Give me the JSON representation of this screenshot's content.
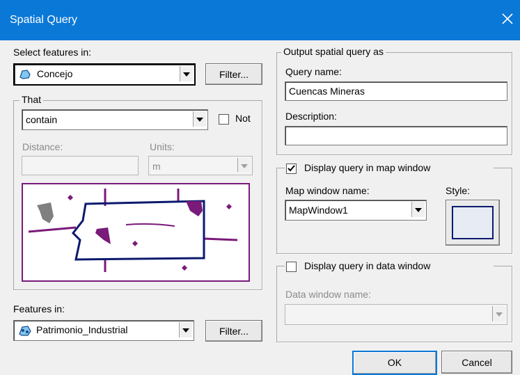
{
  "window": {
    "title": "Spatial Query",
    "close": "✕"
  },
  "select_features": {
    "label": "Select features in:",
    "layer": "Concejo",
    "filter_button": "Filter..."
  },
  "that": {
    "group_label": "That",
    "operator": "contain",
    "not_label": "Not",
    "not_checked": false,
    "distance_label": "Distance:",
    "distance_value": "",
    "units_label": "Units:",
    "units_value": "m"
  },
  "features_in": {
    "label": "Features in:",
    "layer": "Patrimonio_Industrial",
    "filter_button": "Filter..."
  },
  "output": {
    "group_label": "Output spatial query as",
    "query_name_label": "Query name:",
    "query_name_value": "Cuencas Mineras",
    "description_label": "Description:",
    "description_value": ""
  },
  "map_display": {
    "checkbox_label": "Display query in map window",
    "checked": true,
    "map_window_label": "Map window name:",
    "map_window_value": "MapWindow1",
    "style_label": "Style:"
  },
  "data_display": {
    "checkbox_label": "Display query in data window",
    "checked": false,
    "data_window_label": "Data window name:",
    "data_window_value": ""
  },
  "buttons": {
    "ok": "OK",
    "cancel": "Cancel"
  },
  "colors": {
    "title_bar": "#0a78d7",
    "polygon_outline": "#0b1a6e",
    "feature_fill": "#7a1a7a",
    "grey_feature": "#808080"
  }
}
